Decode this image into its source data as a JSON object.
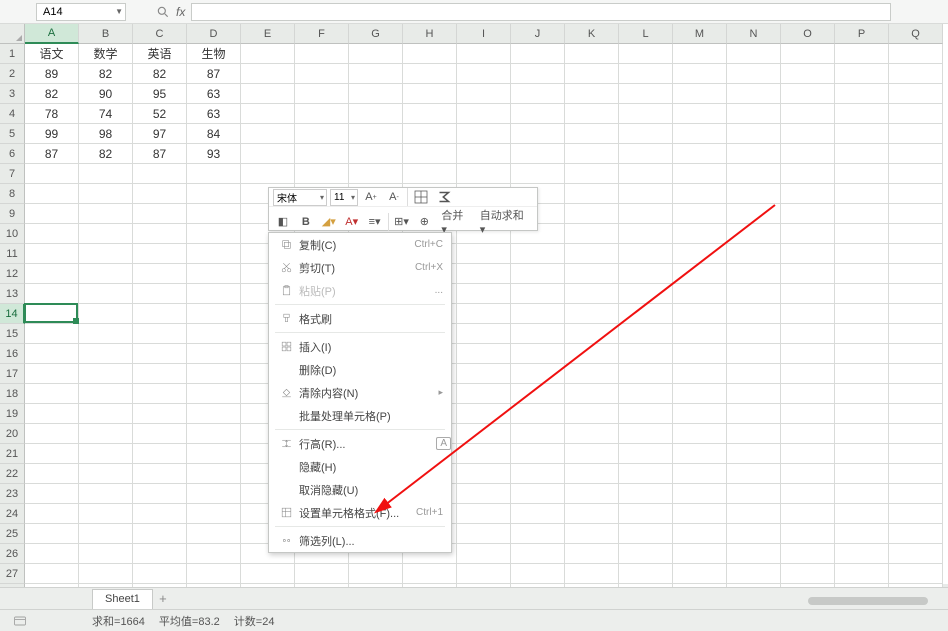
{
  "namebox": "A14",
  "columns": [
    "A",
    "B",
    "C",
    "D",
    "E",
    "F",
    "G",
    "H",
    "I",
    "J",
    "K",
    "L",
    "M",
    "N",
    "O",
    "P",
    "Q"
  ],
  "rows_count": 28,
  "selected_col": "A",
  "selected_row": 14,
  "table": {
    "headers": [
      "语文",
      "数学",
      "英语",
      "生物"
    ],
    "rows": [
      [
        89,
        82,
        82,
        87
      ],
      [
        82,
        90,
        95,
        63
      ],
      [
        78,
        74,
        52,
        63
      ],
      [
        99,
        98,
        97,
        84
      ],
      [
        87,
        82,
        87,
        93
      ]
    ]
  },
  "mini_toolbar": {
    "font": "宋体",
    "size": "11",
    "merge_label": "合并",
    "autosum_label": "自动求和"
  },
  "context_menu": [
    {
      "icon": "copy",
      "label": "复制(C)",
      "shortcut": "Ctrl+C",
      "interact": true
    },
    {
      "icon": "cut",
      "label": "剪切(T)",
      "shortcut": "Ctrl+X",
      "interact": true
    },
    {
      "icon": "paste",
      "label": "粘贴(P)",
      "shortcut": "...",
      "disabled": true
    },
    {
      "sep": true
    },
    {
      "icon": "brush",
      "label": "格式刷",
      "interact": true
    },
    {
      "sep": true
    },
    {
      "icon": "insert",
      "label": "插入(I)",
      "interact": true
    },
    {
      "icon": "",
      "label": "删除(D)",
      "interact": true
    },
    {
      "icon": "clear",
      "label": "清除内容(N)",
      "arrow": true,
      "interact": true
    },
    {
      "icon": "",
      "label": "批量处理单元格(P)",
      "interact": true
    },
    {
      "sep": true
    },
    {
      "icon": "rowh",
      "label": "行高(R)...",
      "badge": "A",
      "interact": true
    },
    {
      "icon": "",
      "label": "隐藏(H)",
      "interact": true
    },
    {
      "icon": "",
      "label": "取消隐藏(U)",
      "interact": true
    },
    {
      "icon": "format",
      "label": "设置单元格格式(F)...",
      "shortcut": "Ctrl+1",
      "interact": true
    },
    {
      "sep": true
    },
    {
      "icon": "filter",
      "label": "筛选列(L)...",
      "interact": true
    }
  ],
  "sheet_tab": "Sheet1",
  "statusbar": {
    "sum_label": "求和",
    "sum": "1664",
    "avg_label": "平均值",
    "avg": "83.2",
    "count_label": "计数",
    "count": "24"
  }
}
